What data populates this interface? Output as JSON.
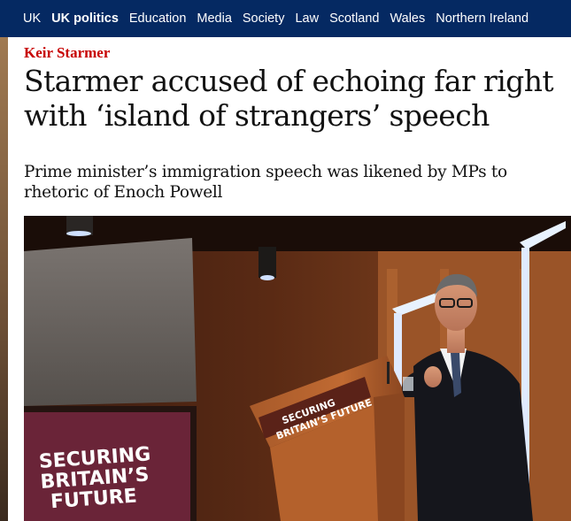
{
  "subnav": {
    "items": [
      {
        "label": "UK",
        "active": false
      },
      {
        "label": "UK politics",
        "active": true
      },
      {
        "label": "Education",
        "active": false
      },
      {
        "label": "Media",
        "active": false
      },
      {
        "label": "Society",
        "active": false
      },
      {
        "label": "Law",
        "active": false
      },
      {
        "label": "Scotland",
        "active": false
      },
      {
        "label": "Wales",
        "active": false
      },
      {
        "label": "Northern Ireland",
        "active": false
      }
    ]
  },
  "article": {
    "kicker": "Keir Starmer",
    "headline": "Starmer accused of echoing far right with ‘island of strangers’ speech",
    "standfirst": "Prime minister’s immigration speech was likened by MPs to rhetoric of Enoch Powell"
  },
  "photo": {
    "screen_text": [
      "SECURING",
      "BRITAIN’S",
      "FUTURE"
    ],
    "lectern_text": [
      "SECURING",
      "BRITAIN’S FUTURE"
    ]
  },
  "colors": {
    "nav_background": "#052962",
    "kicker": "#c70000",
    "text": "#121212"
  }
}
